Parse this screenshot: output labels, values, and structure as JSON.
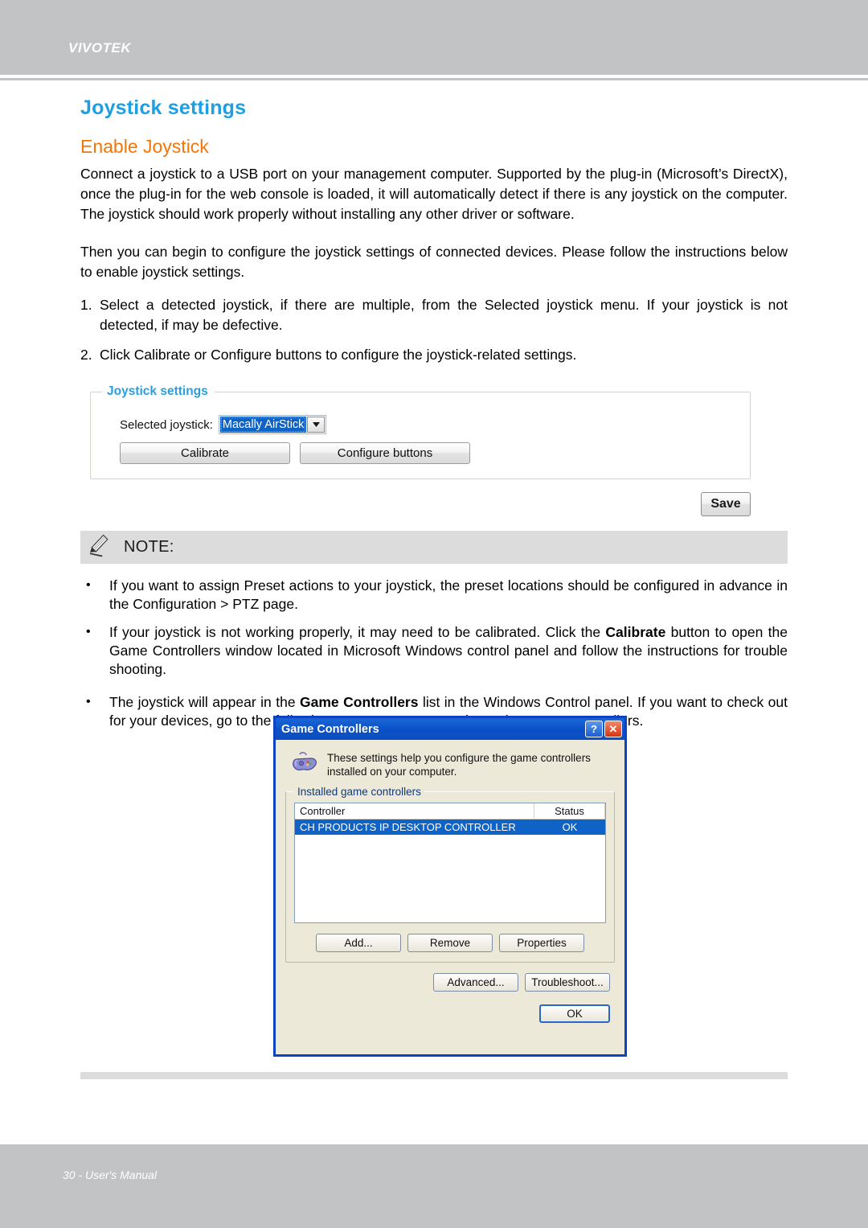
{
  "header": {
    "brand": "VIVOTEK"
  },
  "page": {
    "title": "Joystick settings",
    "section_title": "Enable Joystick",
    "paragraph_1": "Connect a joystick to a USB port on your management computer. Supported by the plug-in (Microsoft’s DirectX), once the plug-in for the web console is loaded, it will automatically detect if there is any joystick on the computer. The joystick should work properly without installing any other driver or software.",
    "paragraph_2": "Then you can begin to configure the joystick settings of connected devices. Please follow the instructions below to enable joystick settings.",
    "steps": [
      {
        "num": "1.",
        "text": "Select a detected joystick, if there are multiple, from the Selected joystick menu. If your joystick is not detected, if may be defective."
      },
      {
        "num": "2.",
        "text": "Click Calibrate or Configure buttons to configure the joystick-related settings."
      }
    ]
  },
  "joystick_panel": {
    "legend": "Joystick settings",
    "selected_joystick_label": "Selected joystick:",
    "selected_joystick_value": "Macally AirStick",
    "calibrate_label": "Calibrate",
    "configure_label": "Configure buttons",
    "save_label": "Save"
  },
  "note": {
    "title": "NOTE:",
    "items": [
      {
        "pre": "If you want to assign Preset actions to your joystick, the preset locations should be configured in advance in the Configuration > PTZ page.",
        "bold": "",
        "post": ""
      },
      {
        "pre": "If your joystick is not working properly, it may need to be calibrated. Click the ",
        "bold": "Calibrate",
        "post": " button to open the Game Controllers window located in Microsoft Windows control panel and follow the instructions for trouble shooting."
      },
      {
        "pre": "The joystick will appear in the ",
        "bold": "Game Controllers",
        "post": " list in the Windows Control panel. If you want to check out for your devices, go to the following page: Start -> Control Panel -> Game Controllers."
      }
    ]
  },
  "dialog": {
    "title": "Game Controllers",
    "help_button": "?",
    "close_button": "✕",
    "intro_text": "These settings help you configure the game controllers installed on your computer.",
    "group_legend": "Installed game controllers",
    "columns": [
      "Controller",
      "Status"
    ],
    "rows": [
      {
        "controller": "CH PRODUCTS IP DESKTOP CONTROLLER",
        "status": "OK"
      }
    ],
    "buttons_row1": [
      "Add...",
      "Remove",
      "Properties"
    ],
    "buttons_row2": [
      "Advanced...",
      "Troubleshoot..."
    ],
    "ok_label": "OK"
  },
  "footer": {
    "text": "30 - User's Manual"
  },
  "colors": {
    "brand_bar": "#c2c3c4",
    "title_blue": "#1e9ee3",
    "section_orange": "#f4760a",
    "selection_blue": "#1063c6",
    "dialog_title_blue": "#0b43c3",
    "dialog_face": "#ece9d8"
  }
}
